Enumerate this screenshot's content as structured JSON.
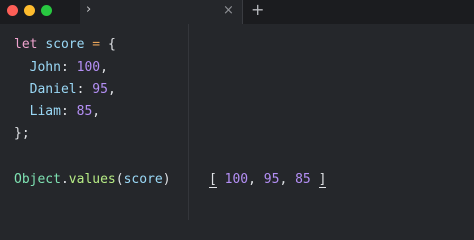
{
  "tabs": [
    {
      "label": "›",
      "active": true
    }
  ],
  "tab_close": "×",
  "new_tab": "+",
  "code": {
    "line1": {
      "keyword": "let",
      "name": "score",
      "op": "=",
      "brace": "{"
    },
    "entries": [
      {
        "key": "John",
        "value": "100"
      },
      {
        "key": "Daniel",
        "value": "95"
      },
      {
        "key": "Liam",
        "value": "85"
      }
    ],
    "close": "};",
    "call": {
      "object": "Object",
      "dot": ".",
      "method": "values",
      "open": "(",
      "arg": "score",
      "close": ")"
    }
  },
  "output": {
    "open": "[",
    "values": [
      "100",
      "95",
      "85"
    ],
    "close": "]"
  },
  "colors": {
    "background": "#25272b",
    "tabbar": "#1b1c1f",
    "keyword": "#f0a3ce",
    "identifier": "#9ad8f6",
    "operator": "#e6a35a",
    "number": "#b48ff5",
    "object": "#7fe3b3",
    "function": "#b6ec85"
  }
}
